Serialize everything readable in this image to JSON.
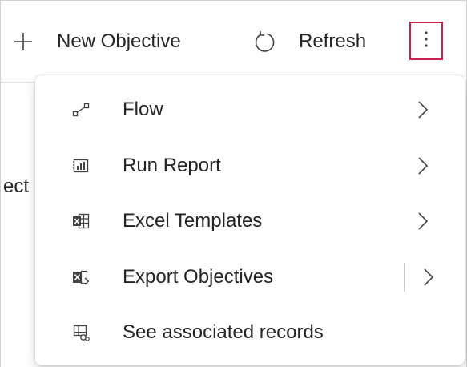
{
  "toolbar": {
    "new_objective_label": "New Objective",
    "refresh_label": "Refresh"
  },
  "background": {
    "column_fragment": "ect"
  },
  "menu": {
    "items": [
      {
        "label": "Flow",
        "icon": "flow-icon",
        "has_submenu": true
      },
      {
        "label": "Run Report",
        "icon": "report-icon",
        "has_submenu": true
      },
      {
        "label": "Excel Templates",
        "icon": "excel-template-icon",
        "has_submenu": true
      },
      {
        "label": "Export Objectives",
        "icon": "excel-export-icon",
        "has_submenu": true,
        "split_button": true
      },
      {
        "label": "See associated records",
        "icon": "associated-records-icon",
        "has_submenu": false
      }
    ]
  },
  "colors": {
    "focus_border": "#c8234e",
    "text": "#242424",
    "icon": "#424242"
  }
}
